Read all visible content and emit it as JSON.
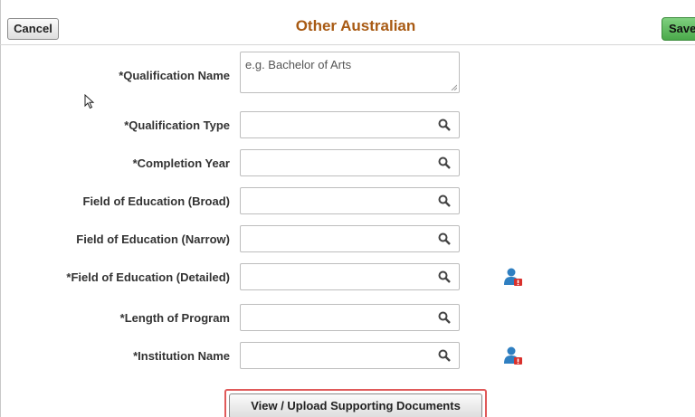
{
  "header": {
    "cancel_label": "Cancel",
    "title": "Other Australian",
    "save_label": "Save"
  },
  "form": {
    "qualification_name": {
      "label": "*Qualification Name",
      "placeholder": "e.g. Bachelor of Arts"
    },
    "fields": [
      {
        "label": "*Qualification Type",
        "value": ""
      },
      {
        "label": "*Completion Year",
        "value": ""
      },
      {
        "label": "Field of Education (Broad)",
        "value": ""
      },
      {
        "label": "Field of Education (Narrow)",
        "value": ""
      },
      {
        "label": "*Field of Education (Detailed)",
        "value": ""
      },
      {
        "label": "*Length of Program",
        "value": ""
      },
      {
        "label": "*Institution Name",
        "value": ""
      }
    ],
    "upload_label": "View / Upload Supporting Documents"
  },
  "icons": {
    "lookup": "search-icon",
    "related_info": "person-info-icon"
  },
  "colors": {
    "title": "#a85a13",
    "save_button": "#5cb85c",
    "highlight_border": "#e05a5a",
    "person_icon": "#2f7fc1"
  }
}
